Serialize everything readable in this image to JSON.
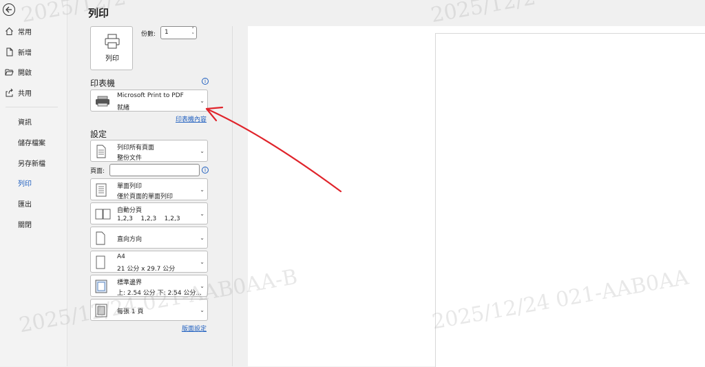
{
  "nav": {
    "items": [
      {
        "label": "常用",
        "icon": "home-icon"
      },
      {
        "label": "新增",
        "icon": "new-document-icon"
      },
      {
        "label": "開啟",
        "icon": "open-folder-icon"
      },
      {
        "label": "共用",
        "icon": "share-icon"
      }
    ],
    "subitems": [
      {
        "label": "資訊"
      },
      {
        "label": "儲存檔案"
      },
      {
        "label": "另存新檔"
      },
      {
        "label": "列印",
        "active": true
      },
      {
        "label": "匯出"
      },
      {
        "label": "關閉"
      }
    ]
  },
  "panel": {
    "title": "列印",
    "print_button": "列印",
    "copies_label": "份數:",
    "copies_value": "1"
  },
  "printer": {
    "heading": "印表機",
    "name": "Microsoft Print to PDF",
    "status": "就緒",
    "properties_link": "印表機內容"
  },
  "settings": {
    "heading": "設定",
    "pages_label": "頁面:",
    "page_setup_link": "版面設定",
    "options": [
      {
        "line1": "列印所有頁面",
        "line2": "整份文件",
        "icon": "pages-icon"
      },
      {
        "line1": "單面列印",
        "line2": "僅於頁面的單面列印",
        "icon": "single-sided-icon"
      },
      {
        "line1": "自動分頁",
        "line2": "1,2,3    1,2,3    1,2,3",
        "icon": "collated-icon"
      },
      {
        "line1": "直向方向",
        "line2": "",
        "icon": "portrait-icon"
      },
      {
        "line1": "A4",
        "line2": "21 公分 x 29.7 公分",
        "icon": "paper-size-icon"
      },
      {
        "line1": "標準邊界",
        "line2": "上: 2.54 公分 下: 2.54 公分...",
        "icon": "margins-icon"
      },
      {
        "line1": "每張 1 頁",
        "line2": "",
        "icon": "pages-per-sheet-icon"
      }
    ]
  },
  "watermarks": [
    "2025/12/2",
    "2025/12/2",
    "2025/12/24  021-AAB0AA-B",
    "2025/12/24  021-AAB0AA"
  ],
  "annotation_color": "#e0242b"
}
